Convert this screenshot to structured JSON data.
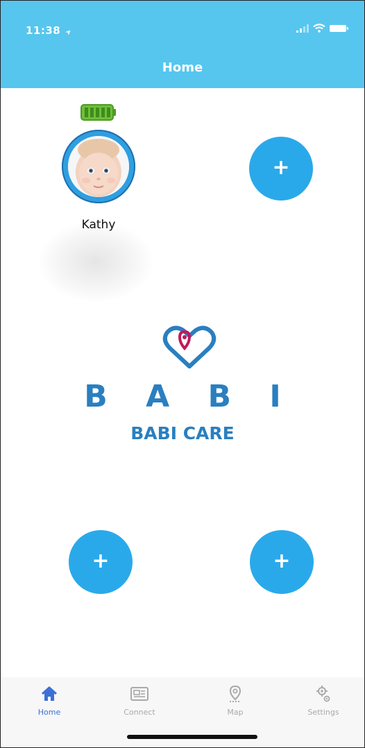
{
  "status_bar": {
    "time": "11:38",
    "location_glyph": "➤"
  },
  "header": {
    "title": "Home"
  },
  "profile": {
    "name": "Kathy",
    "battery_level": 1.0,
    "battery_color": "#6dbf3a",
    "ring_color": "#2f9fe0"
  },
  "add_buttons": {
    "glyph": "+",
    "color": "#2aa9ea"
  },
  "logo": {
    "wordmark": "B A B I",
    "subtitle": "BABI CARE",
    "primary_color": "#2a7fbf",
    "accent_color": "#c2185b"
  },
  "tabs": [
    {
      "label": "Home",
      "icon": "home-icon",
      "active": true
    },
    {
      "label": "Connect",
      "icon": "connect-icon",
      "active": false
    },
    {
      "label": "Map",
      "icon": "map-pin-icon",
      "active": false
    },
    {
      "label": "Settings",
      "icon": "settings-icon",
      "active": false
    }
  ],
  "colors": {
    "header": "#56c6ef",
    "active_tab": "#3b6fd8",
    "inactive_tab": "#a9a9a9"
  }
}
